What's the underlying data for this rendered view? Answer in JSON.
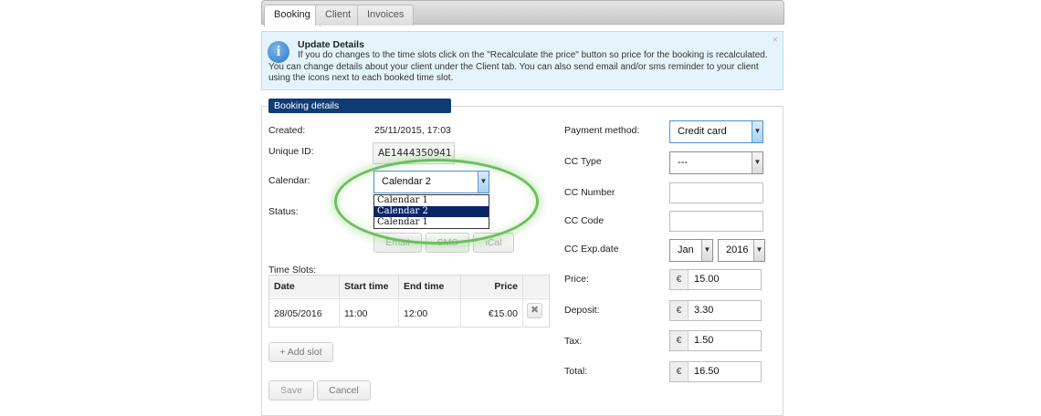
{
  "tabs": [
    {
      "label": "Booking",
      "active": true
    },
    {
      "label": "Client",
      "active": false
    },
    {
      "label": "Invoices",
      "active": false
    }
  ],
  "info": {
    "title": "Update Details",
    "body": "If you do changes to the time slots click on the \"Recalculate the price\" button so price for the booking is recalculated. You can change details about your client under the Client tab. You can also send email and/or sms reminder to your client using the icons next to each booked time slot.",
    "close": "×",
    "icon": "info-icon",
    "icon_glyph": "i"
  },
  "panel": {
    "title": "Booking details",
    "created_label": "Created:",
    "created_value": "25/11/2015, 17:03",
    "uid_label": "Unique ID:",
    "uid_value": "AE1444350941",
    "calendar_label": "Calendar:",
    "calendar_value": "Calendar 2",
    "calendar_options": [
      "Calendar 1",
      "Calendar 2",
      "Calendar 1"
    ],
    "calendar_selected_index": 1,
    "status_label": "Status:",
    "buttons": {
      "email": "Email",
      "sms": "SMS",
      "ical": "iCal"
    },
    "timeslots_label": "Time Slots:",
    "table": {
      "headers": [
        "Date",
        "Start time",
        "End time",
        "Price"
      ],
      "rows": [
        {
          "date": "28/05/2016",
          "start": "11:00",
          "end": "12:00",
          "price": "€15.00"
        }
      ]
    },
    "delete_glyph": "✖",
    "add_slot": "+ Add slot",
    "save": "Save",
    "cancel": "Cancel"
  },
  "payment": {
    "method_label": "Payment method:",
    "method_value": "Credit card",
    "cc_type_label": "CC Type",
    "cc_type_value": "---",
    "cc_number_label": "CC Number",
    "cc_number_value": "",
    "cc_code_label": "CC Code",
    "cc_code_value": "",
    "cc_exp_label": "CC Exp.date",
    "cc_exp_month": "Jan",
    "cc_exp_year": "2016",
    "currency": "€",
    "price_label": "Price:",
    "price_value": "15.00",
    "deposit_label": "Deposit:",
    "deposit_value": "3.30",
    "tax_label": "Tax:",
    "tax_value": "1.50",
    "total_label": "Total:",
    "total_value": "16.50"
  },
  "colors": {
    "header_bg": "#0f3c75",
    "info_bg": "#e5f4fc",
    "highlight_ring": "#6abf5c",
    "selected_option": "#0a246a"
  },
  "dropdown_arrow": "▼"
}
